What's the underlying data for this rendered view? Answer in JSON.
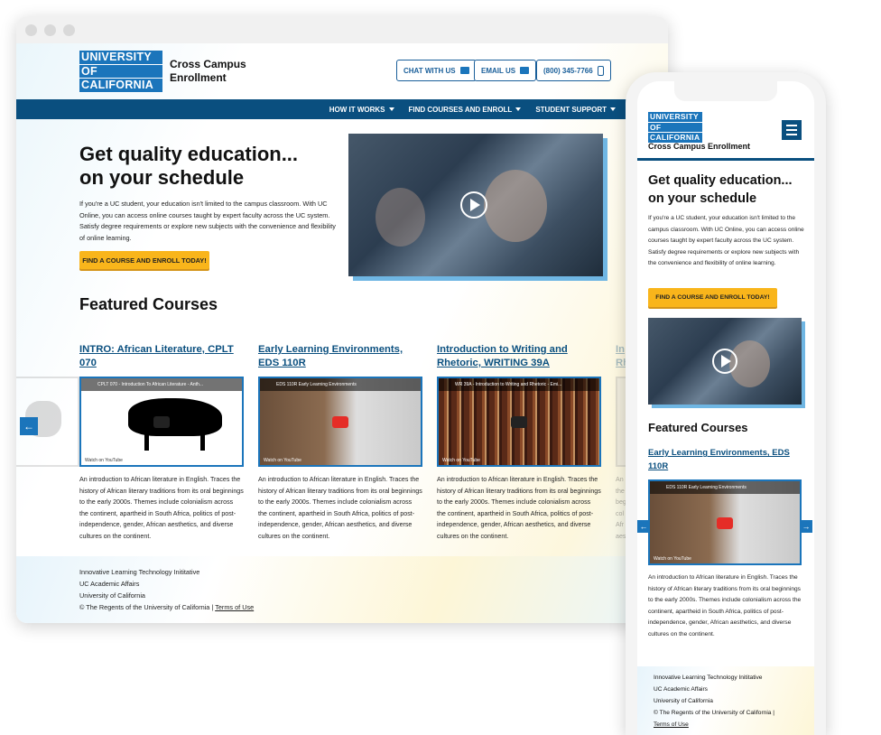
{
  "site": {
    "logo_lines": [
      "UNIVERSITY",
      "OF",
      "CALIFORNIA"
    ],
    "name": "Cross Campus Enrollment",
    "name_line1": "Cross Campus",
    "name_line2": "Enrollment"
  },
  "header": {
    "chat_label": "CHAT WITH US",
    "email_label": "EMAIL US",
    "phone_label": "(800) 345-7766"
  },
  "nav": [
    {
      "label": "HOW IT WORKS"
    },
    {
      "label": "FIND COURSES AND ENROLL"
    },
    {
      "label": "STUDENT SUPPORT"
    }
  ],
  "hero": {
    "title_line1": "Get quality education...",
    "title_line2": "on your schedule",
    "body": "If you're a UC student, your education isn't limited to the campus classroom. With UC Online, you can access online courses taught by expert faculty across the UC system. Satisfy degree requirements or explore new subjects with the convenience and flexibility of online learning.",
    "cta": "FIND A COURSE AND ENROLL TODAY!"
  },
  "featured": {
    "heading": "Featured Courses",
    "courses": [
      {
        "title": "INTRO: African Literature, CPLT 070",
        "video_title": "CPLT 070 - Introduction To African Literature - Anth...",
        "watch": "Watch on YouTube"
      },
      {
        "title": "Early Learning Environments, EDS 110R",
        "video_title": "EDS 110R Early Learning Environments",
        "watch": "Watch on YouTube"
      },
      {
        "title": "Introduction to Writing and Rhetoric, WRITING 39A",
        "video_title": "WR 39A - Introduction to Writing and Rhetoric - Emi...",
        "watch": "Watch on YouTube"
      }
    ],
    "description": "An introduction to African literature in English. Traces the history of African literary traditions from its oral beginnings to the early 2000s. Themes include colonialism across the continent, apartheid in South Africa, politics of post-independence, gender, African aesthetics, and diverse cultures on the continent.",
    "prev_arrow": "←",
    "next_arrow": "→"
  },
  "footer": {
    "line1": "Innovative Learning Technology Inititative",
    "line2": "UC Academic Affairs",
    "line3": "University of California",
    "copyright": "© The Regents of the University of California  |",
    "terms": "Terms of Use"
  },
  "icons": [
    "chat-icon",
    "email-icon",
    "phone-icon",
    "caret-down-icon",
    "play-icon",
    "hamburger-icon",
    "arrow-left-icon",
    "arrow-right-icon"
  ],
  "colors": {
    "brand_blue": "#1b75bb",
    "nav_navy": "#0a4f7f",
    "cta_yellow": "#f9b51b",
    "video_accent": "#6fb6e3"
  }
}
